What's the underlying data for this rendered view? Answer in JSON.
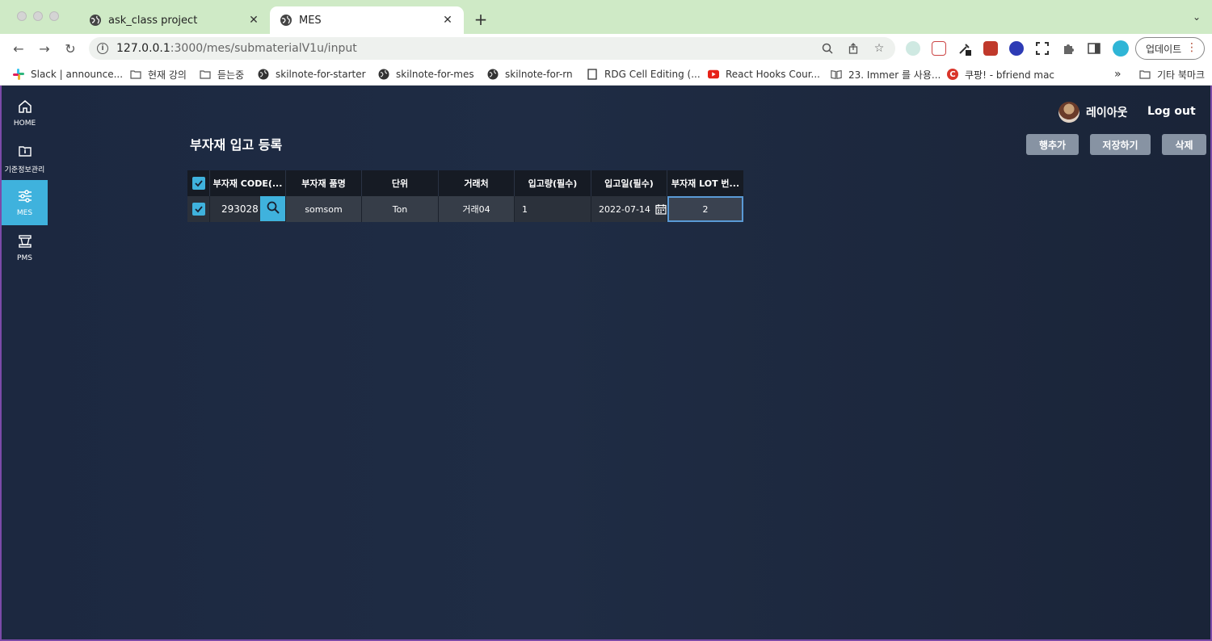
{
  "browser": {
    "tabs": [
      {
        "title": "ask_class project",
        "active": false
      },
      {
        "title": "MES",
        "active": true
      }
    ],
    "url_host": "127.0.0.1",
    "url_path": ":3000/mes/submaterialV1u/input",
    "update_label": "업데이트",
    "bookmarks": [
      {
        "label": "Slack | announce...",
        "icon": "slack-icon"
      },
      {
        "label": "현재 강의",
        "icon": "folder-icon"
      },
      {
        "label": "듣는중",
        "icon": "folder-icon"
      },
      {
        "label": "skilnote-for-starter",
        "icon": "globe-icon"
      },
      {
        "label": "skilnote-for-mes",
        "icon": "globe-icon"
      },
      {
        "label": "skilnote-for-rn",
        "icon": "globe-icon"
      },
      {
        "label": "RDG Cell Editing (...",
        "icon": "page-icon"
      },
      {
        "label": "React Hooks Cour...",
        "icon": "youtube-icon"
      },
      {
        "label": "23. Immer 를 사용...",
        "icon": "book-icon"
      },
      {
        "label": "쿠팡! - bfriend mac",
        "icon": "coupang-icon"
      },
      {
        "label": "기타 북마크",
        "icon": "folder-icon"
      }
    ],
    "bookmarks_more": "»"
  },
  "sidebar": {
    "items": [
      {
        "label": "HOME",
        "icon": "home-icon",
        "active": false
      },
      {
        "label": "기준정보관리",
        "icon": "info-box-icon",
        "active": false
      },
      {
        "label": "MES",
        "icon": "sliders-icon",
        "active": true
      },
      {
        "label": "PMS",
        "icon": "pms-icon",
        "active": false
      }
    ]
  },
  "header": {
    "username": "레이아웃",
    "logout_label": "Log out"
  },
  "page": {
    "title": "부자재 입고 등록",
    "buttons": {
      "add_row": "행추가",
      "save": "저장하기",
      "delete": "삭제"
    }
  },
  "grid": {
    "columns": [
      "부자재 CODE(...",
      "부자재 품명",
      "단위",
      "거래처",
      "입고량(필수)",
      "입고일(필수)",
      "부자재 LOT 번..."
    ],
    "rows": [
      {
        "checked": true,
        "code": "293028",
        "name": "somsom",
        "unit": "Ton",
        "vendor": "거래04",
        "quantity": "1",
        "date": "2022-07-14",
        "lot": "2"
      }
    ],
    "header_checked": true
  },
  "colors": {
    "accent": "#3fb2dd",
    "app_bg": "#1f2c44",
    "button_bg": "#8793a3",
    "tabbar_bg": "#cfeac6"
  }
}
